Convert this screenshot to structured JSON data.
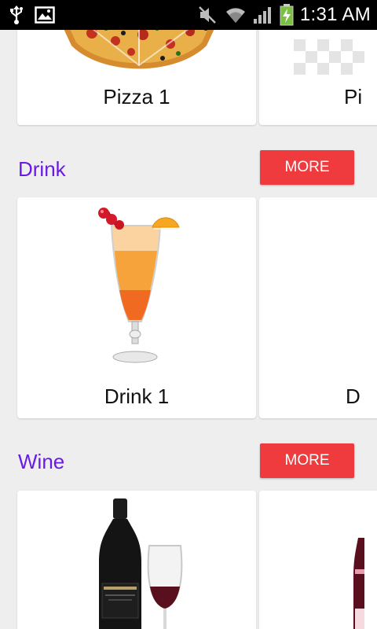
{
  "status_bar": {
    "time": "1:31 AM",
    "icons": [
      "usb-icon",
      "image-icon",
      "mute-icon",
      "wifi-icon",
      "signal-icon",
      "battery-charging-icon"
    ]
  },
  "pizza_section": {
    "items": [
      {
        "label": "Pizza 1",
        "image": "pizza-image"
      },
      {
        "label": "Pi",
        "image": "transparent-placeholder-image"
      }
    ]
  },
  "drink_section": {
    "title": "Drink",
    "more_label": "MORE",
    "items": [
      {
        "label": "Drink 1",
        "image": "cocktail-image"
      },
      {
        "label": "D",
        "image": ""
      }
    ]
  },
  "wine_section": {
    "title": "Wine",
    "more_label": "MORE",
    "items": [
      {
        "label": "",
        "image": "wine-bottle-glass-image"
      },
      {
        "label": "",
        "image": "wine-bottle-image"
      }
    ]
  },
  "colors": {
    "section_title": "#6a1ae6",
    "more_button": "#ef3b3e",
    "background": "#eeeeee",
    "status_bar": "#000000"
  }
}
